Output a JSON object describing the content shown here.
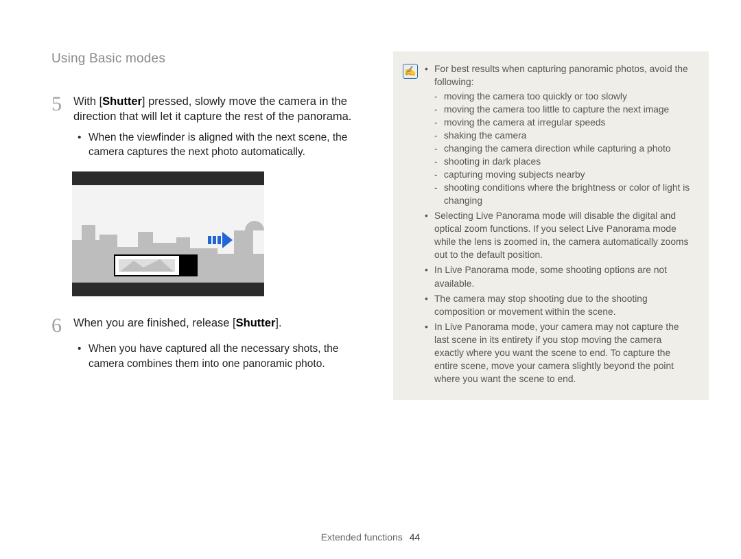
{
  "header": "Using Basic modes",
  "steps": {
    "five": {
      "num": "5",
      "line_pre": "With [",
      "line_bold1": "Shutter",
      "line_post": "] pressed, slowly move the camera in the direction that will let it capture the rest of the panorama.",
      "bullet": "When the viewfinder is aligned with the next scene, the camera captures the next photo automatically."
    },
    "six": {
      "num": "6",
      "line_pre": "When you are finished, release [",
      "line_bold1": "Shutter",
      "line_post": "].",
      "bullet": "When you have captured all the necessary shots, the camera combines them into one panoramic photo."
    }
  },
  "note": {
    "icon": "✍",
    "intro": "For best results when capturing panoramic photos, avoid the following:",
    "avoid": [
      "moving the camera too quickly or too slowly",
      "moving the camera too little to capture the next image",
      "moving the camera at irregular speeds",
      "shaking the camera",
      "changing the camera direction while capturing a photo",
      "shooting in dark places",
      "capturing moving subjects nearby",
      "shooting conditions where the brightness or color of light is changing"
    ],
    "extra": [
      "Selecting Live Panorama mode will disable the digital and optical zoom functions. If you select Live Panorama mode while the lens is zoomed in, the camera automatically zooms out to the default position.",
      "In Live Panorama mode, some shooting options are not available.",
      "The camera may stop shooting due to the shooting composition or movement within the scene.",
      "In Live Panorama mode, your camera may not capture the last scene in its entirety if you stop moving the camera exactly where you want the scene to end. To capture the entire scene, move your camera slightly beyond the point where you want the scene to end."
    ]
  },
  "footer": {
    "section": "Extended functions",
    "page": "44"
  }
}
